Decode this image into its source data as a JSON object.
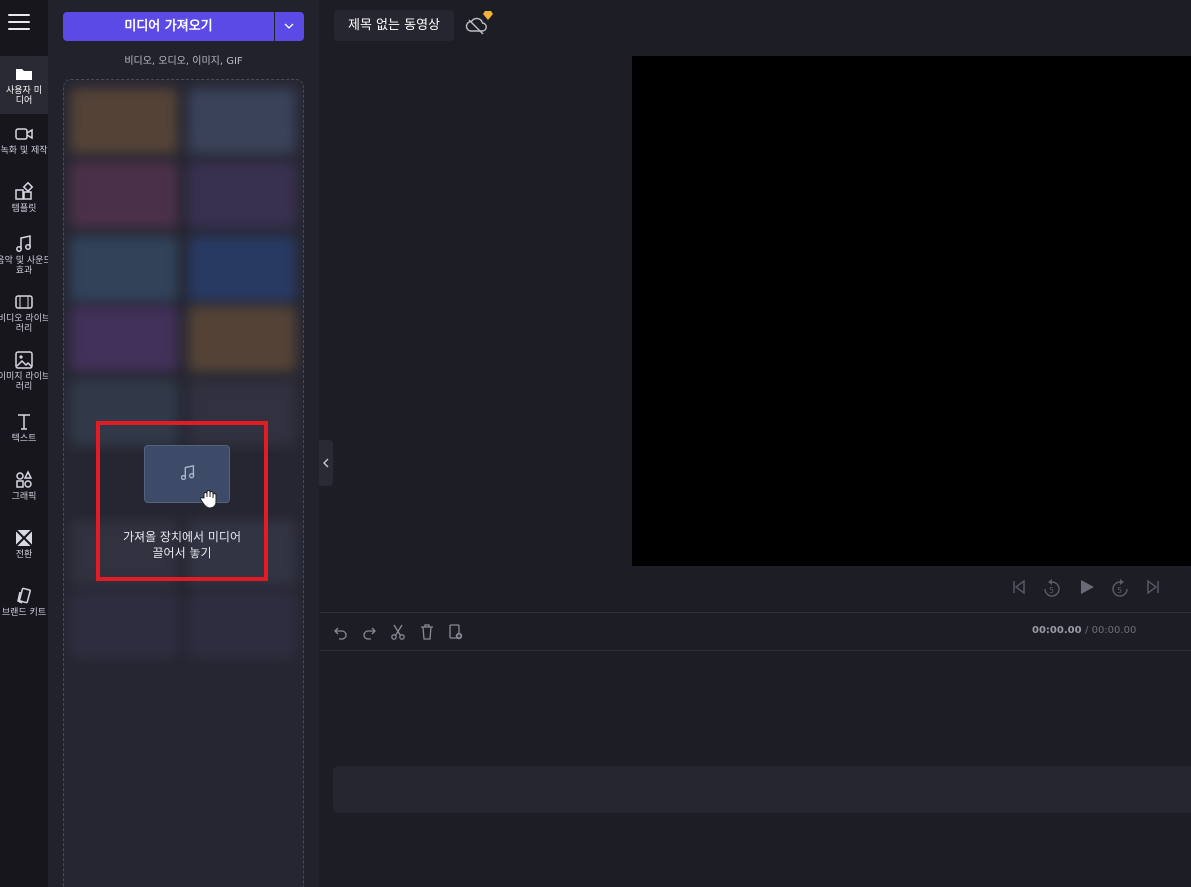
{
  "nav": {
    "items": [
      {
        "label": "사용자 미디어",
        "icon": "folder-icon",
        "active": true
      },
      {
        "label": "녹화 및 제작",
        "icon": "video-camera-icon"
      },
      {
        "label": "템플릿",
        "icon": "templates-icon"
      },
      {
        "label": "음악 및 사운드 효과",
        "icon": "music-icon"
      },
      {
        "label": "비디오 라이브러리",
        "icon": "film-icon"
      },
      {
        "label": "이미지 라이브러리",
        "icon": "image-icon"
      },
      {
        "label": "텍스트",
        "icon": "text-icon"
      },
      {
        "label": "그래픽",
        "icon": "shapes-icon"
      },
      {
        "label": "전환",
        "icon": "transition-icon"
      },
      {
        "label": "브랜드 키트",
        "icon": "brand-kit-icon"
      }
    ]
  },
  "panel": {
    "import_label": "미디어 가져오기",
    "subtitle": "비디오, 오디오, 이미지, GIF",
    "drop_line1": "가져올 장치에서 미디어",
    "drop_line2": "끌어서 놓기"
  },
  "header": {
    "project_title": "제목 없는 동영상"
  },
  "timeline": {
    "current_time": "00:00.00",
    "total_time": "/ 00:00.00"
  },
  "colors": {
    "accent": "#5b4ae6",
    "highlight": "#e31b25"
  }
}
